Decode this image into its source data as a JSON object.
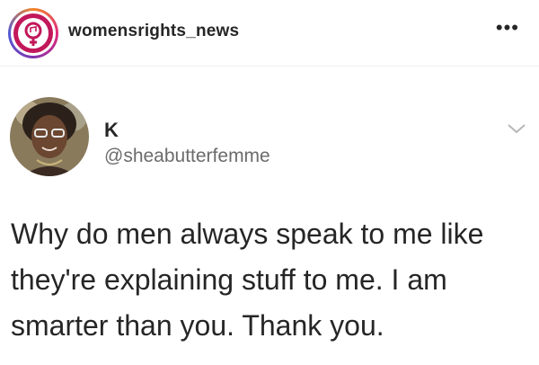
{
  "post_header": {
    "username": "womensrights_news",
    "avatar_icon": "womens-rights-seal-icon",
    "more_icon": "more-dots-icon",
    "more_label": "•••"
  },
  "tweet": {
    "display_name": "K",
    "handle": "@sheabutterfemme",
    "chevron_icon": "chevron-down-icon",
    "text_lines": [
      "Why do men always speak to me like",
      "they're explaining stuff to me. I am",
      "smarter than you. Thank you."
    ]
  },
  "colors": {
    "text": "#262626",
    "handle": "#6b6b6b",
    "seal_pink": "#c2185b",
    "divider": "#efefef"
  }
}
